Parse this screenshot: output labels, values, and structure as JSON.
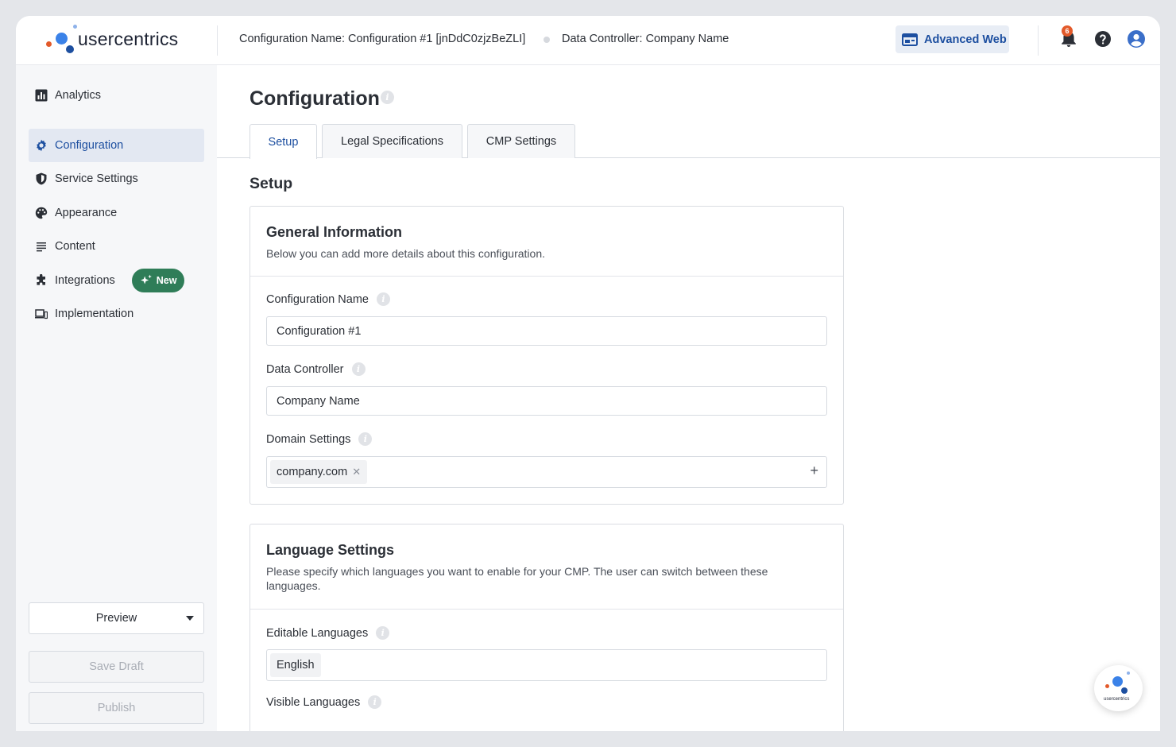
{
  "brand": {
    "name": "usercentrics",
    "colors": {
      "blue": "#1d4fa0",
      "orange": "#e35a2a",
      "light_blue": "#3b82e8",
      "green": "#2f7d58"
    }
  },
  "header": {
    "config_name": "Configuration Name: Configuration #1 [jnDdC0zjzBeZLI]",
    "data_controller": "Data Controller: Company Name",
    "advanced_label": "Advanced Web",
    "notification_count": "6",
    "icons": [
      "browser-window-icon",
      "bell-icon",
      "help-icon",
      "account-icon"
    ]
  },
  "sidebar": {
    "items": [
      {
        "label": "Analytics",
        "icon": "bar-chart-icon"
      },
      {
        "label": "Configuration",
        "icon": "gear-icon",
        "active": true
      },
      {
        "label": "Service Settings",
        "icon": "shield-icon"
      },
      {
        "label": "Appearance",
        "icon": "palette-icon"
      },
      {
        "label": "Content",
        "icon": "text-lines-icon"
      },
      {
        "label": "Integrations",
        "icon": "puzzle-icon",
        "badge": "New"
      },
      {
        "label": "Implementation",
        "icon": "devices-icon"
      }
    ],
    "preview_label": "Preview",
    "save_draft_label": "Save Draft",
    "publish_label": "Publish"
  },
  "main": {
    "title": "Configuration",
    "tabs": [
      {
        "label": "Setup",
        "active": true
      },
      {
        "label": "Legal Specifications"
      },
      {
        "label": "CMP Settings"
      }
    ],
    "section_title": "Setup",
    "general": {
      "title": "General Information",
      "description": "Below you can add more details about this configuration.",
      "config_name_label": "Configuration Name",
      "config_name_value": "Configuration #1",
      "data_controller_label": "Data Controller",
      "data_controller_value": "Company Name",
      "domain_label": "Domain Settings",
      "domain_chip": "company.com"
    },
    "language": {
      "title": "Language Settings",
      "description": "Please specify which languages you want to enable for your CMP. The user can switch between these languages.",
      "editable_label": "Editable Languages",
      "editable_chip": "English",
      "visible_label": "Visible Languages"
    }
  },
  "fab_label": "usercentrics"
}
